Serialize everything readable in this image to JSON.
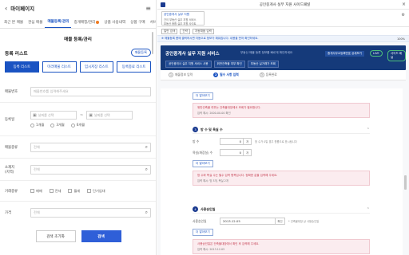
{
  "left": {
    "back_icon": "chevron-left-icon",
    "title": "마이페이지",
    "menu_icon": "hamburger-icon",
    "nav": [
      {
        "label": "최근 본 매물",
        "active": false,
        "dot": false
      },
      {
        "label": "관심 매물",
        "active": false,
        "dot": false
      },
      {
        "label": "매물등록/관리",
        "active": true,
        "dot": false
      },
      {
        "label": "중개매칭/관리",
        "active": false,
        "dot": true
      },
      {
        "label": "상품 사용내역",
        "active": false,
        "dot": false
      },
      {
        "label": "상품 구매",
        "active": false,
        "dot": false
      },
      {
        "label": "서비스 >",
        "active": false,
        "dot": false
      }
    ],
    "page_subtitle": "매물 등록/관리",
    "section_title": "등록 리스트",
    "register_button": "매물등록",
    "segments": [
      "등록 리스트",
      "미러매물 리스트",
      "임시저장 리스트",
      "등록종료 리스트"
    ],
    "form": {
      "listing_no_label": "매물번호",
      "listing_no_placeholder": "매물번호를 입력해주세요",
      "reg_date_label": "등록일",
      "date_from_placeholder": "날짜를 선택",
      "date_to_placeholder": "날짜를 선택",
      "tilde": "~",
      "periods": [
        "1개월",
        "3개월",
        "6개월"
      ],
      "category_label": "매물종류",
      "category_value": "전체",
      "location_label": "소재지\n(지역)",
      "location_value": "전체",
      "trade_label": "거래종류",
      "trade_options": [
        "매매",
        "전세",
        "월세",
        "단기임대"
      ],
      "price_label": "가격",
      "price_value": "전체"
    },
    "reset_button": "검색 초기화",
    "search_button": "검색"
  },
  "right": {
    "window_title": "공인중개사 실무 지원 사이드패널",
    "close_icon": "close-icon",
    "tab_card": {
      "line1": "공인중개사 실무 지원",
      "line2": "간이 부동산 실무 지원 서비스",
      "line3": "부동산 종합 실무 지원 사이트"
    },
    "crumbs": [
      "일반 검색",
      "간략",
      "자동채움 입력"
    ],
    "notice": "※ 매물등록 폼에 클릭하시면 자동으로 정보가 채워집니다. 내용을 먼저 확인하세요.",
    "zoom": "100%",
    "banner": {
      "title": "공인중개사 실무 지원 서비스",
      "subtitle": "부동산 매물 등록 정보를 빠르게 확인하세요",
      "buttons": [
        "공인중개사 실무 지원 서비스 사용",
        "위반건축물 여부 확인",
        "부동산 실거래가 조회"
      ],
      "id_label": "중개사무소등록번호 상세보기",
      "pills": [
        "LIVE",
        "사이드 패널"
      ]
    },
    "steps": [
      {
        "n": "1",
        "label": "매물정보 입력",
        "active": false
      },
      {
        "n": "2",
        "label": "필수 사항 입력",
        "active": true
      },
      {
        "n": "3",
        "label": "등록완료",
        "active": false
      }
    ],
    "blocks": [
      {
        "btn": "더 알아보기",
        "err1": "위반건축물 여부는 건축물대장에서 조회가 필요합니다.",
        "err2": "입력 예시: 2000-00-00 확인"
      },
      {
        "num": "3",
        "title": "방 수 및 욕실 수",
        "room_label": "방 수",
        "room_value": "0",
        "room_unit": "개",
        "room_hint": "방 수가 0일 경우 원룸으로 표시됩니다",
        "bath_label": "욕실(화장실) 수",
        "bath_value": "0",
        "bath_unit": "개",
        "btn": "더 알아보기",
        "err1": "방 수와 욕실 수는 필수 입력 항목입니다. 정확한 값을 입력해 주세요.",
        "err2": "입력 예시: 방 3개, 욕실 2개"
      },
      {
        "num": "4",
        "title": "사용승인일",
        "date_label": "사용승인일",
        "date_value": "2013.12.05",
        "date_unit": "확인",
        "date_hint": "* 건축물대장 상 사용승인일",
        "btn": "더 알아보기",
        "err1": "사용승인일은 건축물대장에서 확인 후 입력해 주세요.",
        "err2": "입력 예시: 2013.12.05"
      }
    ]
  }
}
